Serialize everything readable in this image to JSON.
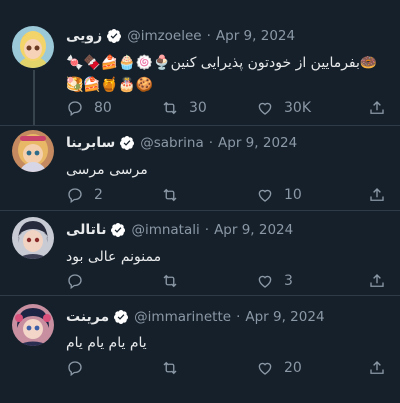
{
  "tweets": [
    {
      "name": "زویی",
      "handle": "@imzoelee",
      "date": "Apr 9, 2024",
      "text_line1": "🍩بفرمایین از خودتون پذیرایی کنین🍨🍥🧁🍰🍫🍬🍭🥞",
      "text_line2": "🍡🍰🍯🎂🍪",
      "replies": "80",
      "retweets": "30",
      "likes": "30K",
      "avatar_color": "#f1d06a"
    },
    {
      "name": "سابرینا",
      "handle": "@sabrina",
      "date": "Apr 9, 2024",
      "text_line1": "مرسی مرسی",
      "replies": "2",
      "retweets": "",
      "likes": "10",
      "avatar_color": "#e3b96a"
    },
    {
      "name": "ناتالی",
      "handle": "@imnatali",
      "date": "Apr 9, 2024",
      "text_line1": "ممنونم عالی بود",
      "replies": "",
      "retweets": "",
      "likes": "3",
      "avatar_color": "#3a3f57"
    },
    {
      "name": "مرینت",
      "handle": "@immarinette",
      "date": "Apr 9, 2024",
      "text_line1": "یام یام یام یام",
      "replies": "",
      "retweets": "",
      "likes": "20",
      "avatar_color": "#2b3357"
    }
  ],
  "colors": {
    "background": "#15202b",
    "muted": "#8b98a5",
    "verified": "#ffffff"
  }
}
